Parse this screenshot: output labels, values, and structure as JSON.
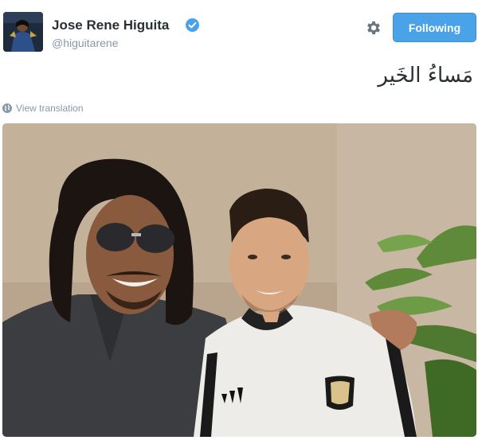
{
  "header": {
    "display_name": "Jose Rene Higuita",
    "handle": "@higuitarene",
    "verified": true,
    "follow_button_label": "Following",
    "accent_color": "#4aa3e8"
  },
  "icons": {
    "verified": "verified-badge-icon",
    "settings": "gear-icon",
    "translate": "globe-icon"
  },
  "tweet": {
    "text": "مَساءُ الخَير",
    "translate_label": "View translation"
  }
}
